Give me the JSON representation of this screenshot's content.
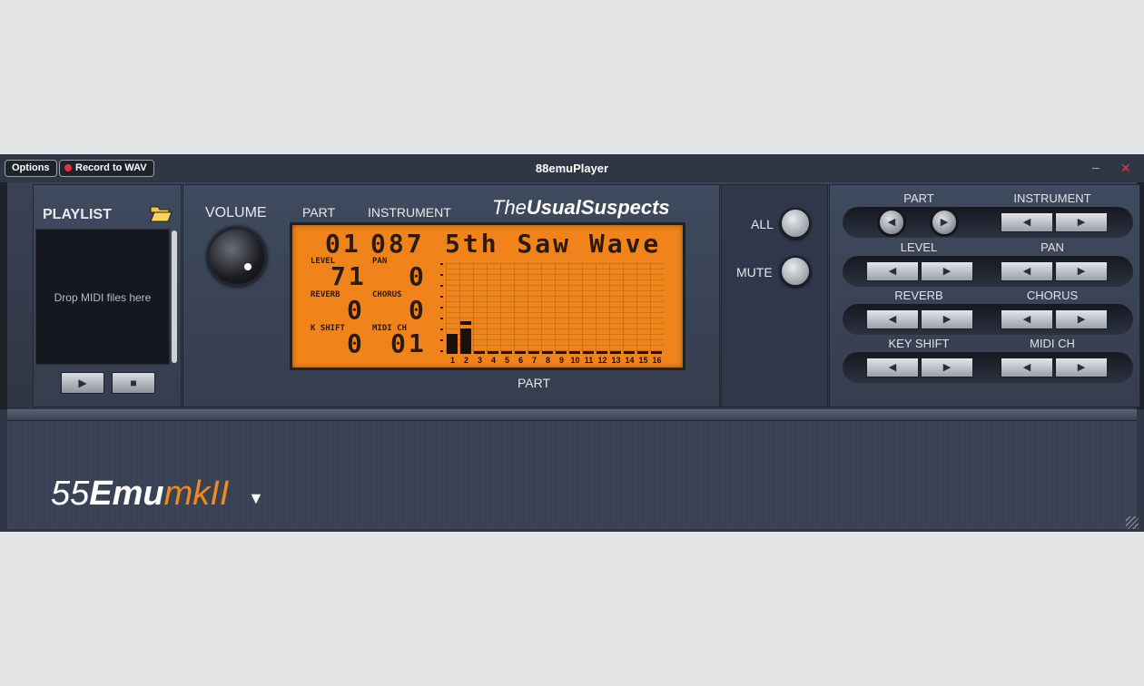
{
  "titlebar": {
    "options_label": "Options",
    "record_label": "Record to WAV",
    "title": "88emuPlayer",
    "minimize_glyph": "–",
    "close_glyph": "✕"
  },
  "playlist": {
    "title": "PLAYLIST",
    "drop_text": "Drop MIDI files here",
    "play_glyph": "▶",
    "stop_glyph": "■"
  },
  "center": {
    "volume_label": "VOLUME",
    "part_header": "PART",
    "instrument_header": "INSTRUMENT",
    "brand_the": "The",
    "brand_usual": "Usual",
    "brand_suspects": "Suspects",
    "part_caption": "PART"
  },
  "lcd": {
    "part": "01",
    "program": "087",
    "instrument_name": "5th Saw Wave",
    "level_label": "LEVEL",
    "level_value": "71",
    "pan_label": "PAN",
    "pan_value": "0",
    "reverb_label": "REVERB",
    "reverb_value": "0",
    "chorus_label": "CHORUS",
    "chorus_value": "0",
    "kshift_label": "K SHIFT",
    "kshift_value": "0",
    "midich_label": "MIDI CH",
    "midich_value": "01",
    "part_numbers": [
      "1",
      "2",
      "3",
      "4",
      "5",
      "6",
      "7",
      "8",
      "9",
      "10",
      "11",
      "12",
      "13",
      "14",
      "15",
      "16"
    ],
    "part_levels": [
      0.22,
      0.28,
      0.02,
      0.02,
      0.02,
      0.02,
      0.02,
      0.02,
      0.02,
      0.02,
      0.02,
      0.02,
      0.02,
      0.02,
      0.02,
      0.02
    ]
  },
  "allmute": {
    "all_label": "ALL",
    "mute_label": "MUTE"
  },
  "controls": {
    "part_label": "PART",
    "instrument_label": "INSTRUMENT",
    "level_label": "LEVEL",
    "pan_label": "PAN",
    "reverb_label": "REVERB",
    "chorus_label": "CHORUS",
    "keyshift_label": "KEY SHIFT",
    "midich_label": "MIDI CH",
    "left_glyph": "◀",
    "right_glyph": "▶"
  },
  "logo": {
    "part1": "55",
    "part2": "Emu",
    "part3": "mkII",
    "caret": "▼"
  },
  "colors": {
    "lcd": "#f0841a",
    "accent": "#f08a1e",
    "record": "#e8303a"
  }
}
